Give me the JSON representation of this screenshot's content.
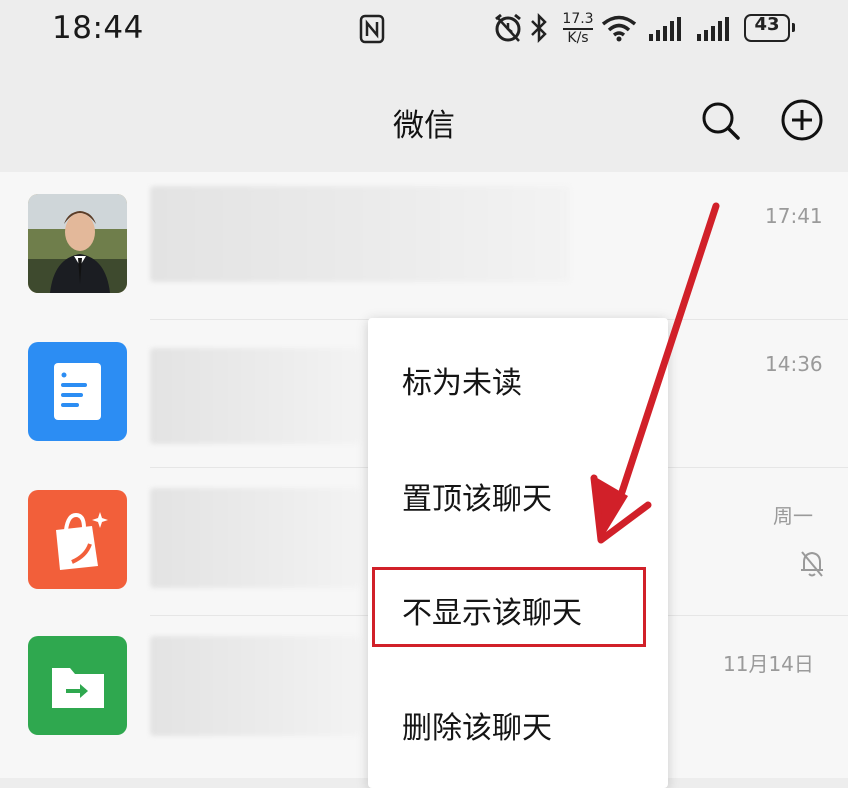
{
  "status_bar": {
    "time": "18:44",
    "net_speed_value": "17.3",
    "net_speed_unit": "K/s",
    "battery": "43",
    "icons": [
      "nfc-icon",
      "alarm-icon",
      "bluetooth-icon",
      "wifi-icon",
      "signal-icon",
      "signal-icon",
      "battery-icon"
    ]
  },
  "header": {
    "title": "微信",
    "icons": [
      "search-icon",
      "add-circle-icon"
    ]
  },
  "chats": [
    {
      "time": "17:41",
      "avatar": "person-photo"
    },
    {
      "time": "14:36",
      "avatar": "document-icon"
    },
    {
      "time": "周一",
      "avatar": "shopping-bag-icon",
      "muted": true
    },
    {
      "time": "11月14日",
      "avatar": "file-transfer-icon"
    }
  ],
  "context_menu": {
    "items": [
      {
        "label": "标为未读"
      },
      {
        "label": "置顶该聊天"
      },
      {
        "label": "不显示该聊天",
        "highlighted": true
      },
      {
        "label": "删除该聊天"
      }
    ]
  },
  "annotation": {
    "color": "#d12029"
  },
  "colors": {
    "doc_icon_bg": "#2c8df3",
    "bag_icon_bg": "#f25f3a",
    "folder_icon_bg": "#2fa84f"
  }
}
